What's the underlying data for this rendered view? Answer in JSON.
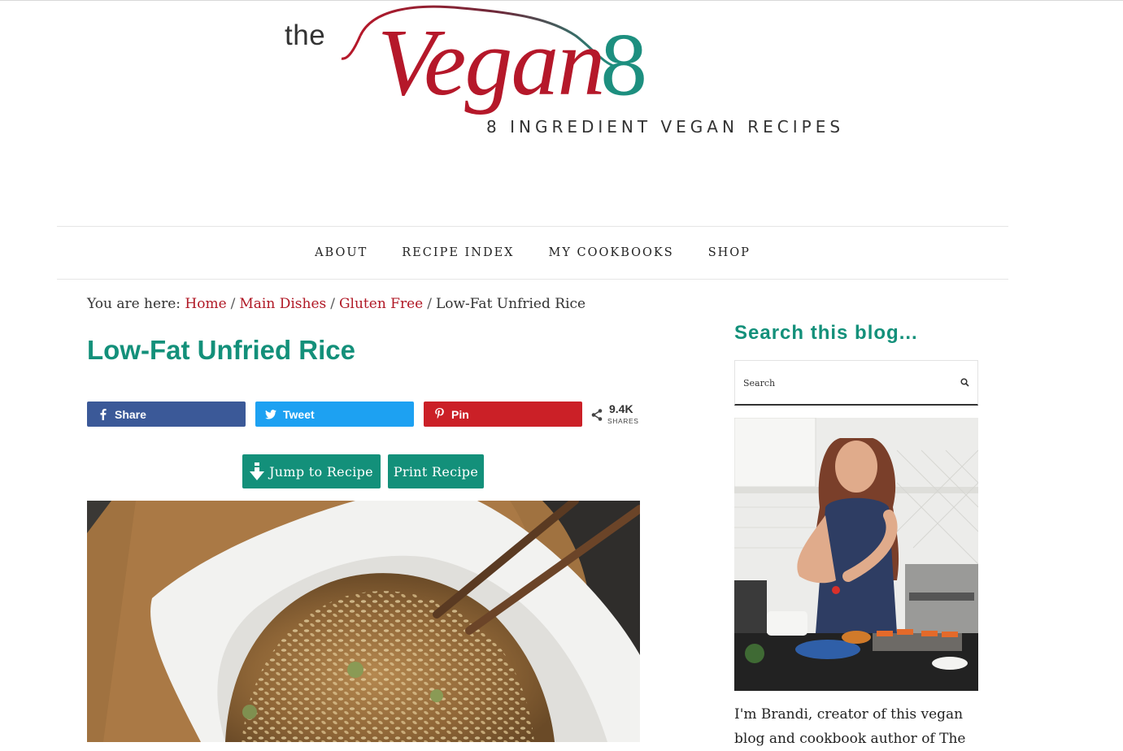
{
  "logo": {
    "the": "the",
    "vegan": "Vegan",
    "eight": "8",
    "tagline": "8 INGREDIENT VEGAN RECIPES"
  },
  "nav": {
    "items": [
      "ABOUT",
      "RECIPE INDEX",
      "MY COOKBOOKS",
      "SHOP"
    ]
  },
  "breadcrumb": {
    "prefix": "You are here:",
    "links": [
      "Home",
      "Main Dishes",
      "Gluten Free"
    ],
    "current": "Low-Fat Unfried Rice",
    "separator": "/"
  },
  "post": {
    "title": "Low-Fat Unfried Rice"
  },
  "social": {
    "facebook": "Share",
    "twitter": "Tweet",
    "pinterest": "Pin",
    "count": "9.4K",
    "count_label": "SHARES"
  },
  "recipe_buttons": {
    "jump": "Jump to Recipe",
    "print": "Print Recipe"
  },
  "sidebar": {
    "search_title": "Search this blog...",
    "search_placeholder": "Search",
    "bio": "I'm Brandi, creator of this vegan blog and cookbook author of The"
  },
  "colors": {
    "brand_teal": "#13907a",
    "brand_red": "#b01825",
    "facebook": "#3b5998",
    "twitter": "#1da1f2",
    "pinterest": "#cb2027"
  },
  "icons": [
    "facebook-icon",
    "twitter-icon",
    "pinterest-icon",
    "share-icon",
    "arrow-down-icon",
    "search-icon"
  ]
}
